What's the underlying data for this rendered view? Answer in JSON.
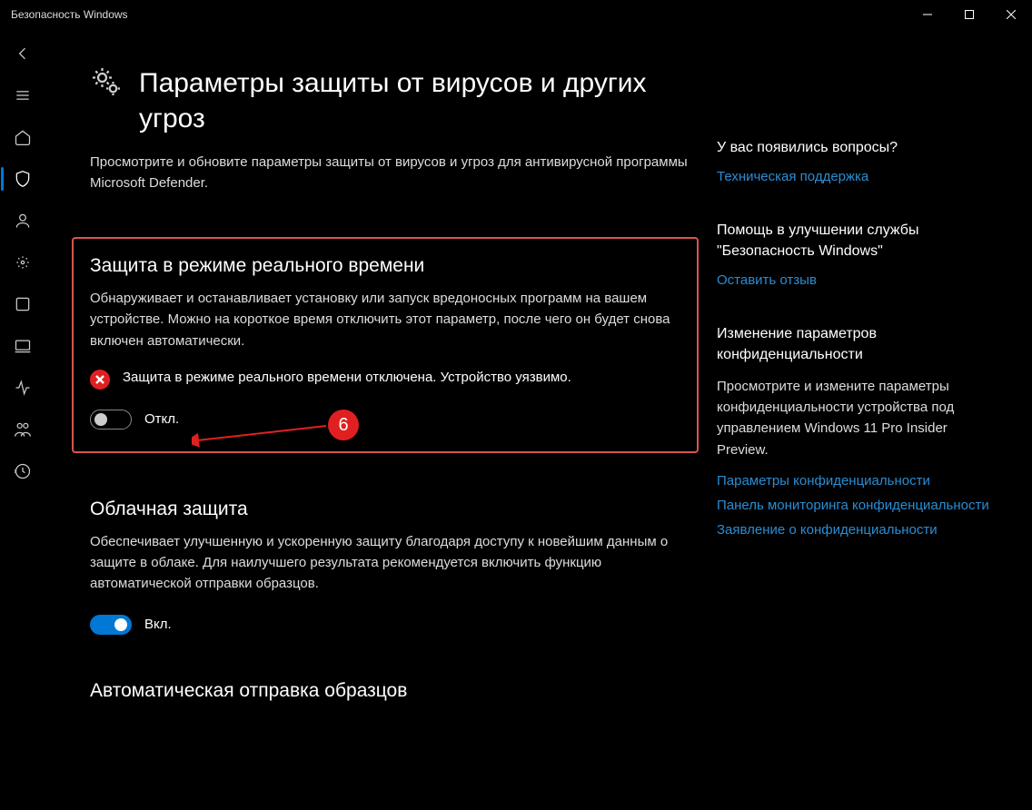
{
  "titlebar": {
    "title": "Безопасность Windows"
  },
  "page": {
    "title": "Параметры защиты от вирусов и других угроз",
    "description": "Просмотрите и обновите параметры защиты от вирусов и угроз для антивирусной программы Microsoft Defender."
  },
  "realtime": {
    "heading": "Защита в режиме реального времени",
    "description": "Обнаруживает и останавливает установку или запуск вредоносных программ на вашем устройстве. Можно на короткое время отключить этот параметр, после чего он будет снова включен автоматически.",
    "warning": "Защита в режиме реального времени отключена. Устройство уязвимо.",
    "toggle_label": "Откл.",
    "annotation_number": "6"
  },
  "cloud": {
    "heading": "Облачная защита",
    "description": "Обеспечивает улучшенную и ускоренную защиту благодаря доступу к новейшим данным о защите в облаке. Для наилучшего результата рекомендуется включить функцию автоматической отправки образцов.",
    "toggle_label": "Вкл."
  },
  "autosample": {
    "heading": "Автоматическая отправка образцов"
  },
  "aside": {
    "questions": {
      "heading": "У вас появились вопросы?",
      "link": "Техническая поддержка"
    },
    "feedback": {
      "heading": "Помощь в улучшении службы \"Безопасность Windows\"",
      "link": "Оставить отзыв"
    },
    "privacy": {
      "heading": "Изменение параметров конфиденциальности",
      "description": "Просмотрите и измените параметры конфиденциальности устройства под управлением Windows 11 Pro Insider Preview.",
      "links": [
        "Параметры конфиденциальности",
        "Панель мониторинга конфиденциальности",
        "Заявление о конфиденциальности"
      ]
    }
  }
}
